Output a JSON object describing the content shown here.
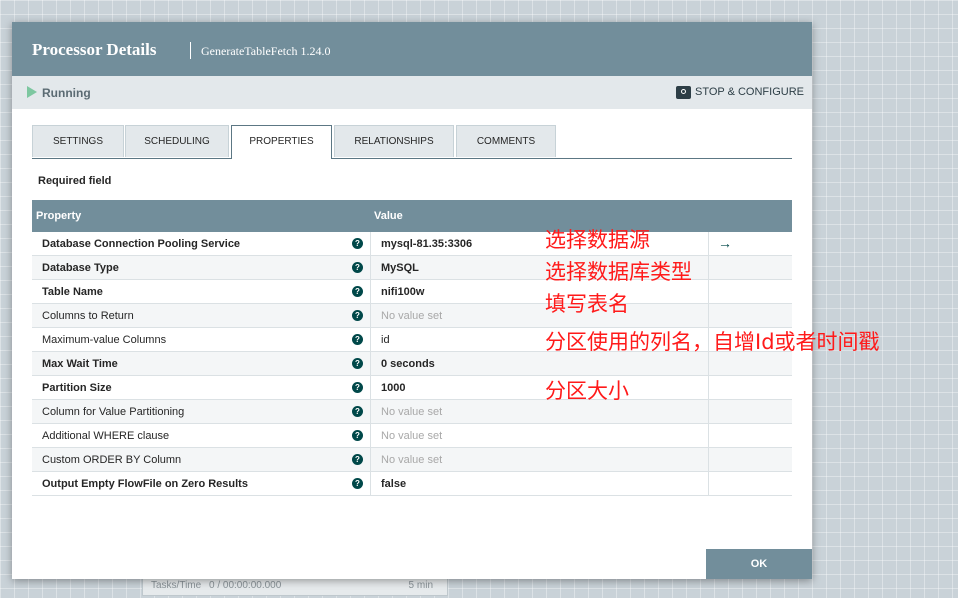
{
  "background_card": {
    "label": "Tasks/Time",
    "value": "0 / 00:00:00.000",
    "window": "5 min"
  },
  "dialog": {
    "title": "Processor Details",
    "subtitle": "GenerateTableFetch 1.24.0",
    "status": {
      "icon": "play-icon",
      "label": "Running",
      "color": "#7dc7a0"
    },
    "stop_configure": {
      "icon": "gear-icon",
      "label": "STOP & CONFIGURE"
    },
    "tabs": [
      {
        "label": "SETTINGS",
        "active": false
      },
      {
        "label": "SCHEDULING",
        "active": false
      },
      {
        "label": "PROPERTIES",
        "active": true
      },
      {
        "label": "RELATIONSHIPS",
        "active": false
      },
      {
        "label": "COMMENTS",
        "active": false
      }
    ],
    "required_field": "Required field",
    "grid": {
      "headers": {
        "property": "Property",
        "value": "Value"
      },
      "rows": [
        {
          "name": "Database Connection Pooling Service",
          "required": true,
          "value": "mysql-81.35:3306",
          "empty": false,
          "has_goto": true
        },
        {
          "name": "Database Type",
          "required": true,
          "value": "MySQL",
          "empty": false,
          "has_goto": false
        },
        {
          "name": "Table Name",
          "required": true,
          "value": "nifi100w",
          "empty": false,
          "has_goto": false
        },
        {
          "name": "Columns to Return",
          "required": false,
          "value": "No value set",
          "empty": true,
          "has_goto": false
        },
        {
          "name": "Maximum-value Columns",
          "required": false,
          "value": "id",
          "empty": false,
          "has_goto": false
        },
        {
          "name": "Max Wait Time",
          "required": true,
          "value": "0 seconds",
          "empty": false,
          "has_goto": false
        },
        {
          "name": "Partition Size",
          "required": true,
          "value": "1000",
          "empty": false,
          "has_goto": false
        },
        {
          "name": "Column for Value Partitioning",
          "required": false,
          "value": "No value set",
          "empty": true,
          "has_goto": false
        },
        {
          "name": "Additional WHERE clause",
          "required": false,
          "value": "No value set",
          "empty": true,
          "has_goto": false
        },
        {
          "name": "Custom ORDER BY Column",
          "required": false,
          "value": "No value set",
          "empty": true,
          "has_goto": false
        },
        {
          "name": "Output Empty FlowFile on Zero Results",
          "required": true,
          "value": "false",
          "empty": false,
          "has_goto": false
        }
      ],
      "help_icon": "?",
      "goto_icon": "→"
    },
    "ok_label": "OK"
  },
  "annotations": [
    "选择数据源",
    "选择数据库类型",
    "填写表名",
    "分区使用的列名，自增Id或者时间戳",
    "分区大小"
  ],
  "colors": {
    "header": "#728e9b",
    "accent": "#004849",
    "annotation": "#ff1a1a"
  }
}
